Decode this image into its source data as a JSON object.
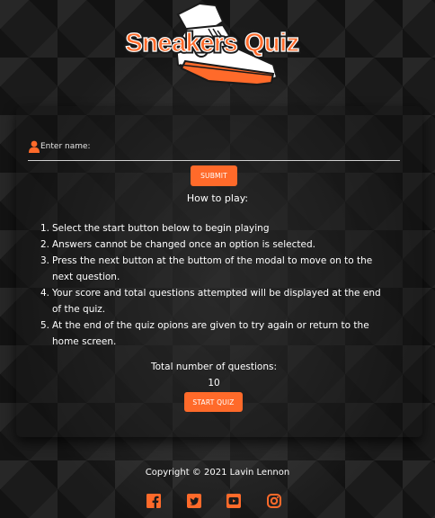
{
  "brand": {
    "logo_text": "Sneakers Quiz",
    "accent_color": "#ff6a2a"
  },
  "form": {
    "name_placeholder": "Enter name:",
    "submit_label": "SUBMIT"
  },
  "instructions": {
    "title": "How to play:",
    "items": [
      {
        "num": "1.",
        "text": "Select the start button below to begin playing"
      },
      {
        "num": "2.",
        "text": "Answers cannot be changed once an option is selected."
      },
      {
        "num": "3.",
        "text": "Press the next button at the buttom of the modal to move on to the next question."
      },
      {
        "num": "4.",
        "text": "Your score and total questions attempted will be displayed at the end of the quiz."
      },
      {
        "num": "5.",
        "text": "At the end of the quiz opions are given to try again or return to the home screen."
      }
    ]
  },
  "quiz": {
    "total_label": "Total number of questions:",
    "total_value": "10",
    "start_label": "START QUIZ"
  },
  "footer": {
    "copyright": "Copyright © 2021 Lavin Lennon",
    "social_icons": [
      "facebook-icon",
      "twitter-icon",
      "youtube-icon",
      "instagram-icon"
    ]
  }
}
